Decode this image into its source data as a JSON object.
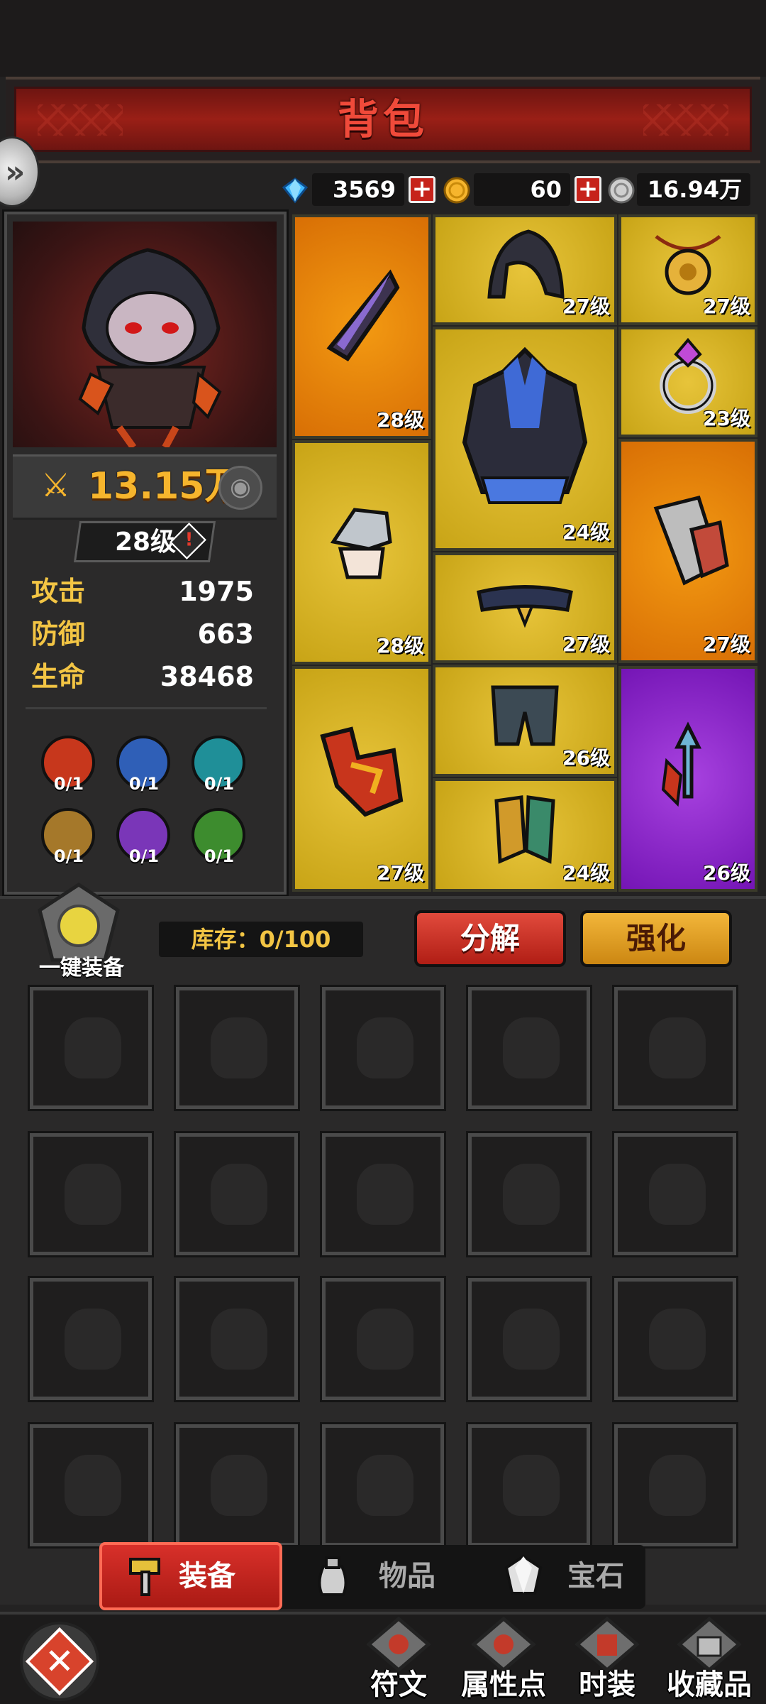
{
  "header": {
    "title": "背包"
  },
  "currency": {
    "diamond": "3569",
    "gold": "60",
    "silver": "16.94万"
  },
  "character": {
    "power": "13.15万",
    "level": "28级",
    "stats": [
      {
        "label": "攻击",
        "value": "1975"
      },
      {
        "label": "防御",
        "value": "663"
      },
      {
        "label": "生命",
        "value": "38468"
      }
    ],
    "elements": [
      {
        "icon": "fire-element-icon",
        "color": "#c7371c",
        "count": "0/1"
      },
      {
        "icon": "lightning-element-icon",
        "color": "#2f5fb7",
        "count": "0/1"
      },
      {
        "icon": "ice-element-icon",
        "color": "#1f8f98",
        "count": "0/1"
      },
      {
        "icon": "earth-element-icon",
        "color": "#a5782a",
        "count": "0/1"
      },
      {
        "icon": "dark-element-icon",
        "color": "#7a36b8",
        "count": "0/1"
      },
      {
        "icon": "wind-element-icon",
        "color": "#3d8c2e",
        "count": "0/1"
      }
    ]
  },
  "equipment": {
    "slots": [
      {
        "name": "weapon",
        "icon": "dagger-icon",
        "rarity": "orange",
        "level": "28级"
      },
      {
        "name": "helmet",
        "icon": "hood-icon",
        "rarity": "gold",
        "level": "27级"
      },
      {
        "name": "necklace",
        "icon": "amulet-icon",
        "rarity": "gold",
        "level": "27级"
      },
      {
        "name": "ring",
        "icon": "ring-icon",
        "rarity": "gold",
        "level": "23级"
      },
      {
        "name": "armor",
        "icon": "armor-icon",
        "rarity": "gold",
        "level": "24级"
      },
      {
        "name": "shoulder",
        "icon": "shoulder-icon",
        "rarity": "gold",
        "level": "28级"
      },
      {
        "name": "gloves",
        "icon": "bracer-icon",
        "rarity": "orange",
        "level": "27级"
      },
      {
        "name": "belt",
        "icon": "belt-icon",
        "rarity": "gold",
        "level": "27级"
      },
      {
        "name": "offhand",
        "icon": "claw-icon",
        "rarity": "gold",
        "level": "27级"
      },
      {
        "name": "pants",
        "icon": "pants-icon",
        "rarity": "gold",
        "level": "26级"
      },
      {
        "name": "boots",
        "icon": "boots-icon",
        "rarity": "gold",
        "level": "24级"
      },
      {
        "name": "relic",
        "icon": "trident-relic-icon",
        "rarity": "purple",
        "level": "26级"
      }
    ]
  },
  "inventory": {
    "equip_all_label": "一键装备",
    "stock": "库存：0/100",
    "decompose_label": "分解",
    "enhance_label": "强化",
    "empty_slot_icon": "bag-icon"
  },
  "tabs": [
    {
      "label": "装备",
      "icon": "hammer-icon",
      "active": true
    },
    {
      "label": "物品",
      "icon": "bag-icon",
      "active": false
    },
    {
      "label": "宝石",
      "icon": "gem-icon",
      "active": false
    }
  ],
  "bottom_nav": [
    {
      "label": "符文",
      "icon": "rune-icon"
    },
    {
      "label": "属性点",
      "icon": "attribute-icon"
    },
    {
      "label": "时装",
      "icon": "costume-icon"
    },
    {
      "label": "收藏品",
      "icon": "collection-icon"
    }
  ],
  "colors": {
    "accent_red": "#c6231b",
    "gold_text": "#f3c544",
    "rarity_gold": "#d9b628",
    "rarity_orange": "#e98209",
    "rarity_purple": "#8e2ccb"
  }
}
